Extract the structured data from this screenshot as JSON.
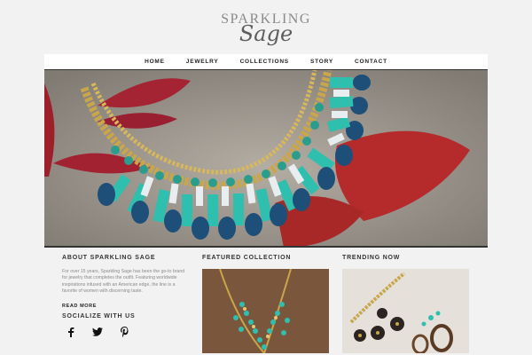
{
  "logo": {
    "line1": "SPARKLING",
    "line2": "Sage"
  },
  "nav": [
    "HOME",
    "JEWELRY",
    "COLLECTIONS",
    "STORY",
    "CONTACT"
  ],
  "about": {
    "title": "ABOUT SPARKLING SAGE",
    "text": "For over 15 years, Sparkling Sage has been the go-to brand for jewelry that completes the outfit. Featuring worldwide inspirations infused with an American edge, the line is a favorite of women with discerning taste.",
    "read_more": "READ MORE",
    "social_title": "SOCIALIZE WITH US",
    "social": [
      "facebook-icon",
      "twitter-icon",
      "pinterest-icon"
    ]
  },
  "featured": {
    "title": "FEATURED COLLECTION"
  },
  "trending": {
    "title": "TRENDING NOW"
  },
  "colors": {
    "teal": "#2fbfae",
    "navy_stone": "#1e4f78",
    "gold": "#c9a64a",
    "leaf_red": "#b22a2a",
    "stone_bg": "#9e9890"
  }
}
